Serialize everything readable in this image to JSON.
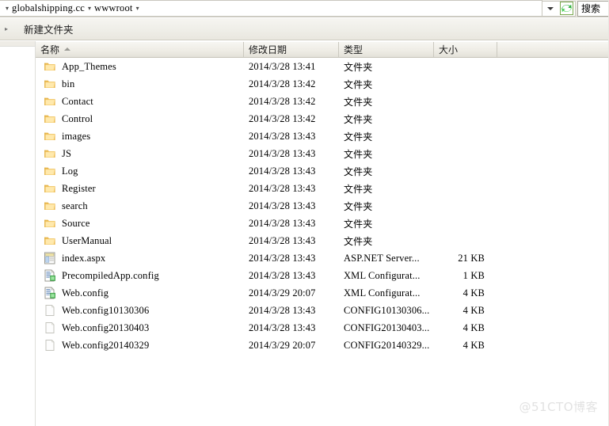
{
  "address_bar": {
    "crumbs": [
      "globalshipping.cc",
      "wwwroot"
    ],
    "dropdown_icon": "chevron-down-icon",
    "refresh_icon": "refresh-icon",
    "separator": "▸"
  },
  "search": {
    "placeholder": "搜索",
    "value": "搜索"
  },
  "toolbar": {
    "chevron": "▸",
    "new_folder_label": "新建文件夹"
  },
  "columns": {
    "name": "名称",
    "date_modified": "修改日期",
    "type": "类型",
    "size": "大小",
    "extra": "",
    "sort_column": "名称",
    "sort_direction": "ascending"
  },
  "files": [
    {
      "name": "App_Themes",
      "date": "2014/3/28 13:41",
      "type": "文件夹",
      "size": "",
      "icon": "folder-icon"
    },
    {
      "name": "bin",
      "date": "2014/3/28 13:42",
      "type": "文件夹",
      "size": "",
      "icon": "folder-icon"
    },
    {
      "name": "Contact",
      "date": "2014/3/28 13:42",
      "type": "文件夹",
      "size": "",
      "icon": "folder-icon"
    },
    {
      "name": "Control",
      "date": "2014/3/28 13:42",
      "type": "文件夹",
      "size": "",
      "icon": "folder-icon"
    },
    {
      "name": "images",
      "date": "2014/3/28 13:43",
      "type": "文件夹",
      "size": "",
      "icon": "folder-icon"
    },
    {
      "name": "JS",
      "date": "2014/3/28 13:43",
      "type": "文件夹",
      "size": "",
      "icon": "folder-icon"
    },
    {
      "name": "Log",
      "date": "2014/3/28 13:43",
      "type": "文件夹",
      "size": "",
      "icon": "folder-icon"
    },
    {
      "name": "Register",
      "date": "2014/3/28 13:43",
      "type": "文件夹",
      "size": "",
      "icon": "folder-icon"
    },
    {
      "name": "search",
      "date": "2014/3/28 13:43",
      "type": "文件夹",
      "size": "",
      "icon": "folder-icon"
    },
    {
      "name": "Source",
      "date": "2014/3/28 13:43",
      "type": "文件夹",
      "size": "",
      "icon": "folder-icon"
    },
    {
      "name": "UserManual",
      "date": "2014/3/28 13:43",
      "type": "文件夹",
      "size": "",
      "icon": "folder-icon"
    },
    {
      "name": "index.aspx",
      "date": "2014/3/28 13:43",
      "type": "ASP.NET Server...",
      "size": "21 KB",
      "icon": "aspx-file-icon"
    },
    {
      "name": "PrecompiledApp.config",
      "date": "2014/3/28 13:43",
      "type": "XML Configurat...",
      "size": "1 KB",
      "icon": "xml-config-icon"
    },
    {
      "name": "Web.config",
      "date": "2014/3/29 20:07",
      "type": "XML Configurat...",
      "size": "4 KB",
      "icon": "xml-config-icon"
    },
    {
      "name": "Web.config10130306",
      "date": "2014/3/28 13:43",
      "type": "CONFIG10130306...",
      "size": "4 KB",
      "icon": "blank-file-icon"
    },
    {
      "name": "Web.config20130403",
      "date": "2014/3/28 13:43",
      "type": "CONFIG20130403...",
      "size": "4 KB",
      "icon": "blank-file-icon"
    },
    {
      "name": "Web.config20140329",
      "date": "2014/3/29 20:07",
      "type": "CONFIG20140329...",
      "size": "4 KB",
      "icon": "blank-file-icon"
    }
  ],
  "watermark": {
    "text": "@51CTO博客"
  },
  "colors": {
    "chrome": "#efeee8",
    "folder": "#fcd77f",
    "accent_green": "#3bb54a",
    "header_border": "#c6c4ba",
    "watermark": "#e2e2e2"
  }
}
